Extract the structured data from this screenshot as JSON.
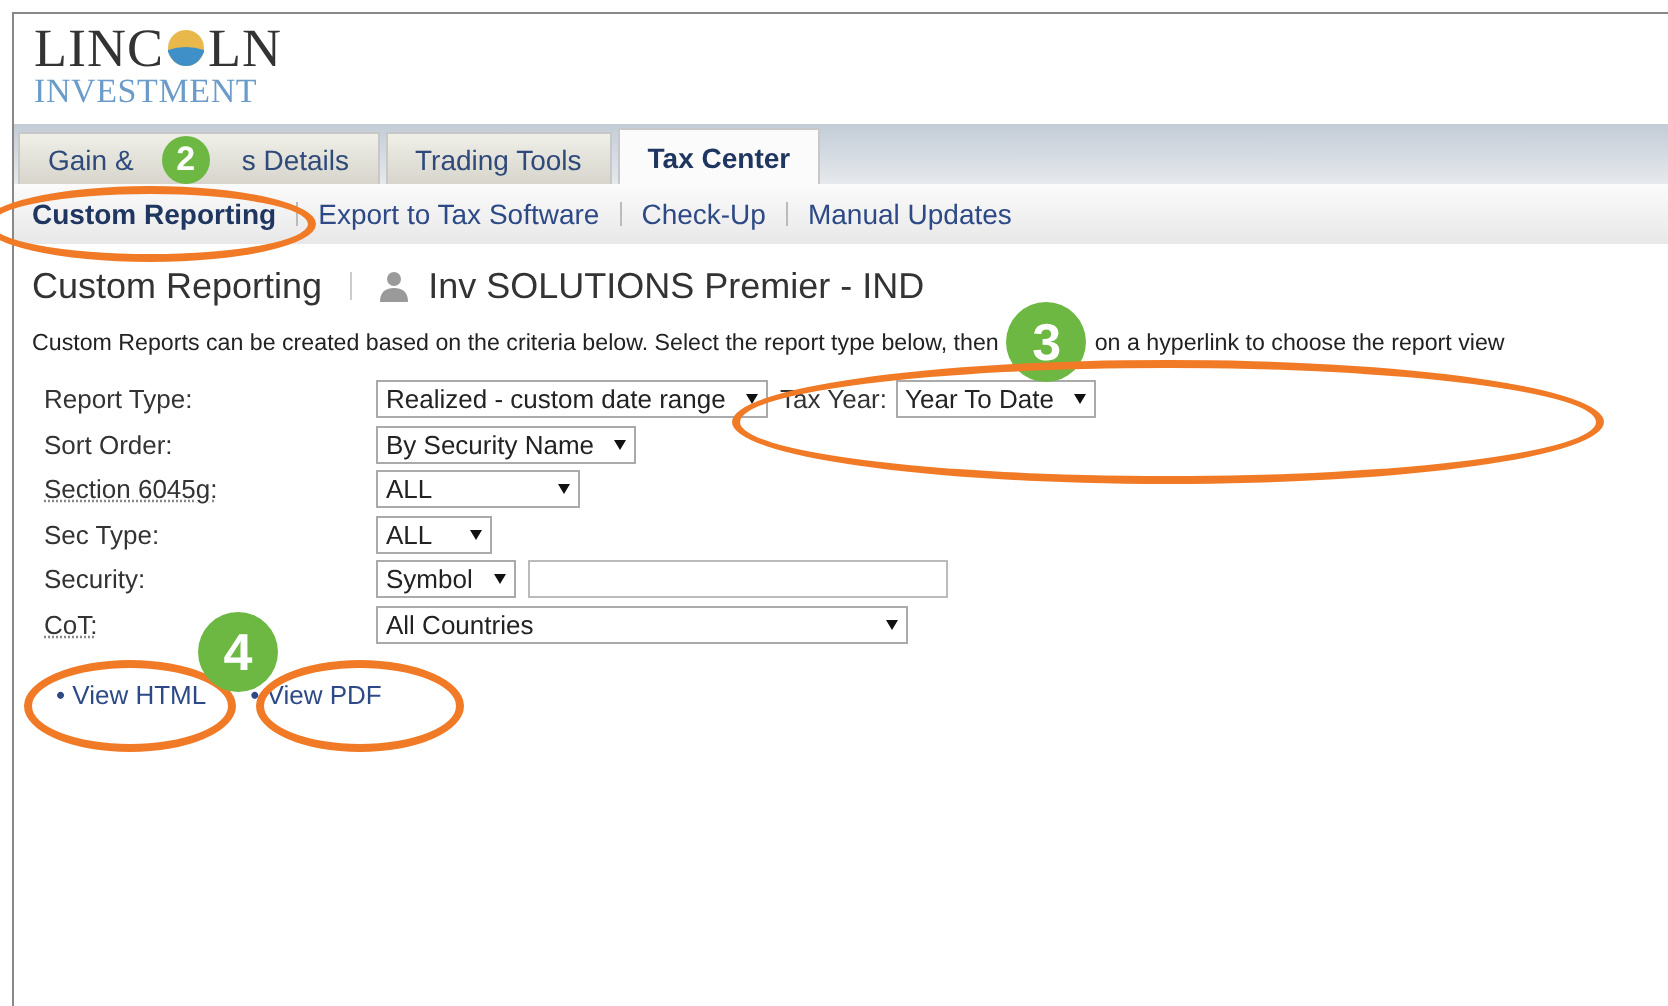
{
  "logo": {
    "left": "LINC",
    "right": "LN",
    "subtitle": "INVESTMENT"
  },
  "tabs": [
    {
      "label": "Gain &",
      "label_after": "s Details",
      "selected": false
    },
    {
      "label": "Trading Tools",
      "selected": false
    },
    {
      "label": "Tax Center",
      "selected": true
    }
  ],
  "subnav": [
    {
      "label": "Custom Reporting",
      "selected": true
    },
    {
      "label": "Export to Tax Software",
      "selected": false
    },
    {
      "label": "Check-Up",
      "selected": false
    },
    {
      "label": "Manual Updates",
      "selected": false
    }
  ],
  "page_title": "Custom Reporting",
  "account": "Inv SOLUTIONS Premier - IND",
  "description": "Custom Reports can be created based on the criteria below. Select the report type below, then",
  "description_after": "on a hyperlink to choose the report view",
  "form": [
    {
      "label": "Report Type:",
      "underlined": false,
      "controls": [
        {
          "kind": "select",
          "value": "Realized - custom date range"
        },
        {
          "kind": "label",
          "text": "Tax Year:"
        },
        {
          "kind": "select",
          "value": "Year To Date"
        }
      ]
    },
    {
      "label": "Sort Order:",
      "underlined": false,
      "controls": [
        {
          "kind": "select",
          "value": "By Security Name"
        }
      ]
    },
    {
      "label": "Section 6045g:",
      "underlined": true,
      "controls": [
        {
          "kind": "select",
          "value": "ALL"
        }
      ]
    },
    {
      "label": "Sec Type:",
      "underlined": false,
      "controls": [
        {
          "kind": "select",
          "value": "ALL"
        }
      ]
    },
    {
      "label": "Security:",
      "underlined": false,
      "controls": [
        {
          "kind": "select",
          "value": "Symbol"
        },
        {
          "kind": "input"
        }
      ]
    },
    {
      "label": "CoT:",
      "underlined": true,
      "controls": [
        {
          "kind": "select",
          "value": "All Countries"
        }
      ]
    }
  ],
  "links": [
    "• View HTML",
    "• View PDF"
  ],
  "callouts": [
    {
      "number": "2"
    },
    {
      "number": "3"
    },
    {
      "number": "4"
    }
  ]
}
